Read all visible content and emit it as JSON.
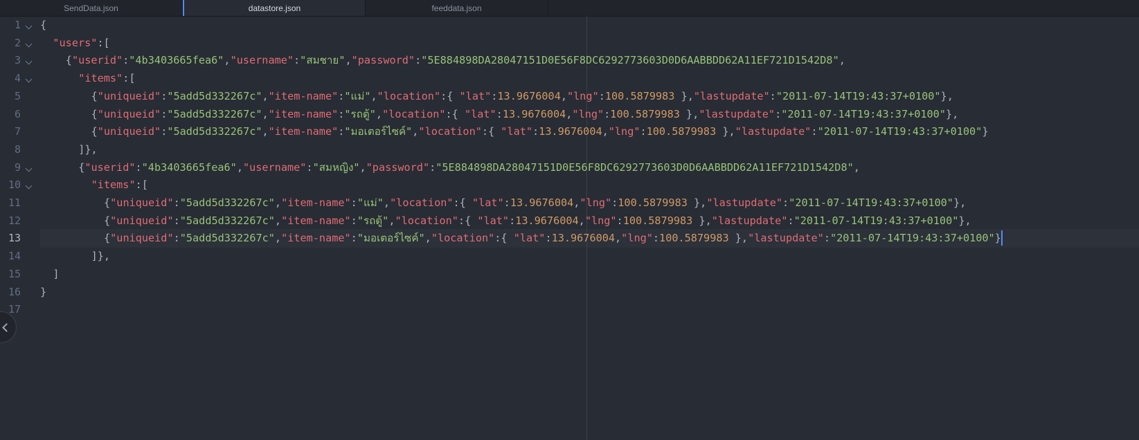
{
  "tabs": [
    {
      "label": "SendData.json",
      "active": false
    },
    {
      "label": "datastore.json",
      "active": true
    },
    {
      "label": "feeddata.json",
      "active": false
    }
  ],
  "cursor_line": 13,
  "lines": [
    {
      "n": 1,
      "fold": true,
      "indent": 0,
      "tokens": [
        [
          "p",
          "{"
        ]
      ]
    },
    {
      "n": 2,
      "fold": true,
      "indent": 2,
      "tokens": [
        [
          "k",
          "\"users\""
        ],
        [
          "p",
          ":["
        ]
      ]
    },
    {
      "n": 3,
      "fold": true,
      "indent": 4,
      "tokens": [
        [
          "p",
          "{"
        ],
        [
          "k",
          "\"userid\""
        ],
        [
          "p",
          ":"
        ],
        [
          "s",
          "\"4b3403665fea6\""
        ],
        [
          "p",
          ","
        ],
        [
          "k",
          "\"username\""
        ],
        [
          "p",
          ":"
        ],
        [
          "s",
          "\"สมชาย\""
        ],
        [
          "p",
          ","
        ],
        [
          "k",
          "\"password\""
        ],
        [
          "p",
          ":"
        ],
        [
          "s",
          "\"5E884898DA28047151D0E56F8DC6292773603D0D6AABBDD62A11EF721D1542D8\""
        ],
        [
          "p",
          ","
        ]
      ]
    },
    {
      "n": 4,
      "fold": true,
      "indent": 6,
      "tokens": [
        [
          "k",
          "\"items\""
        ],
        [
          "p",
          ":["
        ]
      ]
    },
    {
      "n": 5,
      "fold": false,
      "indent": 8,
      "tokens": [
        [
          "p",
          "{"
        ],
        [
          "k",
          "\"uniqueid\""
        ],
        [
          "p",
          ":"
        ],
        [
          "s",
          "\"5add5d332267c\""
        ],
        [
          "p",
          ","
        ],
        [
          "k",
          "\"item-name\""
        ],
        [
          "p",
          ":"
        ],
        [
          "s",
          "\"แม่\""
        ],
        [
          "p",
          ","
        ],
        [
          "k",
          "\"location\""
        ],
        [
          "p",
          ":{ "
        ],
        [
          "k",
          "\"lat\""
        ],
        [
          "p",
          ":"
        ],
        [
          "n",
          "13.9676004"
        ],
        [
          "p",
          ","
        ],
        [
          "k",
          "\"lng\""
        ],
        [
          "p",
          ":"
        ],
        [
          "n",
          "100.5879983"
        ],
        [
          "p",
          " },"
        ],
        [
          "k",
          "\"lastupdate\""
        ],
        [
          "p",
          ":"
        ],
        [
          "s",
          "\"2011-07-14T19:43:37+0100\""
        ],
        [
          "p",
          "},"
        ]
      ]
    },
    {
      "n": 6,
      "fold": false,
      "indent": 8,
      "tokens": [
        [
          "p",
          "{"
        ],
        [
          "k",
          "\"uniqueid\""
        ],
        [
          "p",
          ":"
        ],
        [
          "s",
          "\"5add5d332267c\""
        ],
        [
          "p",
          ","
        ],
        [
          "k",
          "\"item-name\""
        ],
        [
          "p",
          ":"
        ],
        [
          "s",
          "\"รถตู้\""
        ],
        [
          "p",
          ","
        ],
        [
          "k",
          "\"location\""
        ],
        [
          "p",
          ":{ "
        ],
        [
          "k",
          "\"lat\""
        ],
        [
          "p",
          ":"
        ],
        [
          "n",
          "13.9676004"
        ],
        [
          "p",
          ","
        ],
        [
          "k",
          "\"lng\""
        ],
        [
          "p",
          ":"
        ],
        [
          "n",
          "100.5879983"
        ],
        [
          "p",
          " },"
        ],
        [
          "k",
          "\"lastupdate\""
        ],
        [
          "p",
          ":"
        ],
        [
          "s",
          "\"2011-07-14T19:43:37+0100\""
        ],
        [
          "p",
          "},"
        ]
      ]
    },
    {
      "n": 7,
      "fold": false,
      "indent": 8,
      "tokens": [
        [
          "p",
          "{"
        ],
        [
          "k",
          "\"uniqueid\""
        ],
        [
          "p",
          ":"
        ],
        [
          "s",
          "\"5add5d332267c\""
        ],
        [
          "p",
          ","
        ],
        [
          "k",
          "\"item-name\""
        ],
        [
          "p",
          ":"
        ],
        [
          "s",
          "\"มอเตอร์ไซค์\""
        ],
        [
          "p",
          ","
        ],
        [
          "k",
          "\"location\""
        ],
        [
          "p",
          ":{ "
        ],
        [
          "k",
          "\"lat\""
        ],
        [
          "p",
          ":"
        ],
        [
          "n",
          "13.9676004"
        ],
        [
          "p",
          ","
        ],
        [
          "k",
          "\"lng\""
        ],
        [
          "p",
          ":"
        ],
        [
          "n",
          "100.5879983"
        ],
        [
          "p",
          " },"
        ],
        [
          "k",
          "\"lastupdate\""
        ],
        [
          "p",
          ":"
        ],
        [
          "s",
          "\"2011-07-14T19:43:37+0100\""
        ],
        [
          "p",
          "}"
        ]
      ]
    },
    {
      "n": 8,
      "fold": false,
      "indent": 6,
      "tokens": [
        [
          "p",
          "]},"
        ]
      ]
    },
    {
      "n": 9,
      "fold": true,
      "indent": 6,
      "tokens": [
        [
          "p",
          "{"
        ],
        [
          "k",
          "\"userid\""
        ],
        [
          "p",
          ":"
        ],
        [
          "s",
          "\"4b3403665fea6\""
        ],
        [
          "p",
          ","
        ],
        [
          "k",
          "\"username\""
        ],
        [
          "p",
          ":"
        ],
        [
          "s",
          "\"สมหญิง\""
        ],
        [
          "p",
          ","
        ],
        [
          "k",
          "\"password\""
        ],
        [
          "p",
          ":"
        ],
        [
          "s",
          "\"5E884898DA28047151D0E56F8DC6292773603D0D6AABBDD62A11EF721D1542D8\""
        ],
        [
          "p",
          ","
        ]
      ]
    },
    {
      "n": 10,
      "fold": true,
      "indent": 8,
      "tokens": [
        [
          "k",
          "\"items\""
        ],
        [
          "p",
          ":["
        ]
      ]
    },
    {
      "n": 11,
      "fold": false,
      "indent": 10,
      "tokens": [
        [
          "p",
          "{"
        ],
        [
          "k",
          "\"uniqueid\""
        ],
        [
          "p",
          ":"
        ],
        [
          "s",
          "\"5add5d332267c\""
        ],
        [
          "p",
          ","
        ],
        [
          "k",
          "\"item-name\""
        ],
        [
          "p",
          ":"
        ],
        [
          "s",
          "\"แม่\""
        ],
        [
          "p",
          ","
        ],
        [
          "k",
          "\"location\""
        ],
        [
          "p",
          ":{ "
        ],
        [
          "k",
          "\"lat\""
        ],
        [
          "p",
          ":"
        ],
        [
          "n",
          "13.9676004"
        ],
        [
          "p",
          ","
        ],
        [
          "k",
          "\"lng\""
        ],
        [
          "p",
          ":"
        ],
        [
          "n",
          "100.5879983"
        ],
        [
          "p",
          " },"
        ],
        [
          "k",
          "\"lastupdate\""
        ],
        [
          "p",
          ":"
        ],
        [
          "s",
          "\"2011-07-14T19:43:37+0100\""
        ],
        [
          "p",
          "},"
        ]
      ]
    },
    {
      "n": 12,
      "fold": false,
      "indent": 10,
      "tokens": [
        [
          "p",
          "{"
        ],
        [
          "k",
          "\"uniqueid\""
        ],
        [
          "p",
          ":"
        ],
        [
          "s",
          "\"5add5d332267c\""
        ],
        [
          "p",
          ","
        ],
        [
          "k",
          "\"item-name\""
        ],
        [
          "p",
          ":"
        ],
        [
          "s",
          "\"รถตู้\""
        ],
        [
          "p",
          ","
        ],
        [
          "k",
          "\"location\""
        ],
        [
          "p",
          ":{ "
        ],
        [
          "k",
          "\"lat\""
        ],
        [
          "p",
          ":"
        ],
        [
          "n",
          "13.9676004"
        ],
        [
          "p",
          ","
        ],
        [
          "k",
          "\"lng\""
        ],
        [
          "p",
          ":"
        ],
        [
          "n",
          "100.5879983"
        ],
        [
          "p",
          " },"
        ],
        [
          "k",
          "\"lastupdate\""
        ],
        [
          "p",
          ":"
        ],
        [
          "s",
          "\"2011-07-14T19:43:37+0100\""
        ],
        [
          "p",
          "},"
        ]
      ]
    },
    {
      "n": 13,
      "fold": false,
      "indent": 10,
      "tokens": [
        [
          "p",
          "{"
        ],
        [
          "k",
          "\"uniqueid\""
        ],
        [
          "p",
          ":"
        ],
        [
          "s",
          "\"5add5d332267c\""
        ],
        [
          "p",
          ","
        ],
        [
          "k",
          "\"item-name\""
        ],
        [
          "p",
          ":"
        ],
        [
          "s",
          "\"มอเตอร์ไซค์\""
        ],
        [
          "p",
          ","
        ],
        [
          "k",
          "\"location\""
        ],
        [
          "p",
          ":{ "
        ],
        [
          "k",
          "\"lat\""
        ],
        [
          "p",
          ":"
        ],
        [
          "n",
          "13.9676004"
        ],
        [
          "p",
          ","
        ],
        [
          "k",
          "\"lng\""
        ],
        [
          "p",
          ":"
        ],
        [
          "n",
          "100.5879983"
        ],
        [
          "p",
          " },"
        ],
        [
          "k",
          "\"lastupdate\""
        ],
        [
          "p",
          ":"
        ],
        [
          "s",
          "\"2011-07-14T19:43:37+0100\""
        ],
        [
          "p",
          "}"
        ]
      ]
    },
    {
      "n": 14,
      "fold": false,
      "indent": 8,
      "tokens": [
        [
          "p",
          "]},"
        ]
      ]
    },
    {
      "n": 15,
      "fold": false,
      "indent": 2,
      "tokens": [
        [
          "p",
          "]"
        ]
      ]
    },
    {
      "n": 16,
      "fold": false,
      "indent": 0,
      "tokens": [
        [
          "p",
          "}"
        ]
      ]
    },
    {
      "n": 17,
      "fold": false,
      "indent": 0,
      "tokens": []
    }
  ],
  "icons": {
    "fold": "chevron-down-icon",
    "collapse": "chevron-left-icon"
  },
  "colors": {
    "background": "#282c34",
    "key": "#e06c75",
    "string": "#98c379",
    "number": "#d19a66",
    "punctuation": "#abb2bf",
    "cursor": "#528bff"
  }
}
